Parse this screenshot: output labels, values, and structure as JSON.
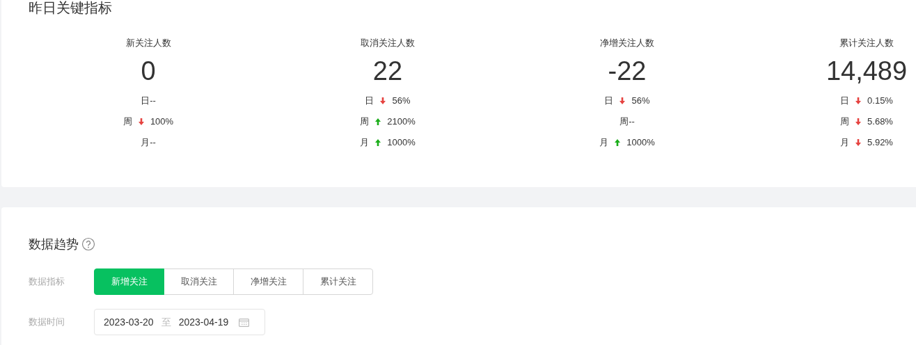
{
  "key_metrics": {
    "title": "昨日关键指标",
    "metrics": [
      {
        "label": "新关注人数",
        "value": "0",
        "changes": [
          {
            "period": "日",
            "kind": "plain",
            "value": "--"
          },
          {
            "period": "周",
            "kind": "down",
            "value": "100%"
          },
          {
            "period": "月",
            "kind": "plain",
            "value": "--"
          }
        ]
      },
      {
        "label": "取消关注人数",
        "value": "22",
        "changes": [
          {
            "period": "日",
            "kind": "down",
            "value": "56%"
          },
          {
            "period": "周",
            "kind": "up",
            "value": "2100%"
          },
          {
            "period": "月",
            "kind": "up",
            "value": "1000%"
          }
        ]
      },
      {
        "label": "净增关注人数",
        "value": "-22",
        "changes": [
          {
            "period": "日",
            "kind": "down",
            "value": "56%"
          },
          {
            "period": "周",
            "kind": "plain",
            "value": "--"
          },
          {
            "period": "月",
            "kind": "up",
            "value": "1000%"
          }
        ]
      },
      {
        "label": "累计关注人数",
        "value": "14,489",
        "changes": [
          {
            "period": "日",
            "kind": "down",
            "value": "0.15%"
          },
          {
            "period": "周",
            "kind": "down",
            "value": "5.68%"
          },
          {
            "period": "月",
            "kind": "down",
            "value": "5.92%"
          }
        ]
      }
    ]
  },
  "trend": {
    "title": "数据趋势",
    "metric_label": "数据指标",
    "tabs": [
      {
        "label": "新增关注",
        "selected": true
      },
      {
        "label": "取消关注",
        "selected": false
      },
      {
        "label": "净增关注",
        "selected": false
      },
      {
        "label": "累计关注",
        "selected": false
      }
    ],
    "time_label": "数据时间",
    "date_from": "2023-03-20",
    "date_separator": "至",
    "date_to": "2023-04-19"
  }
}
